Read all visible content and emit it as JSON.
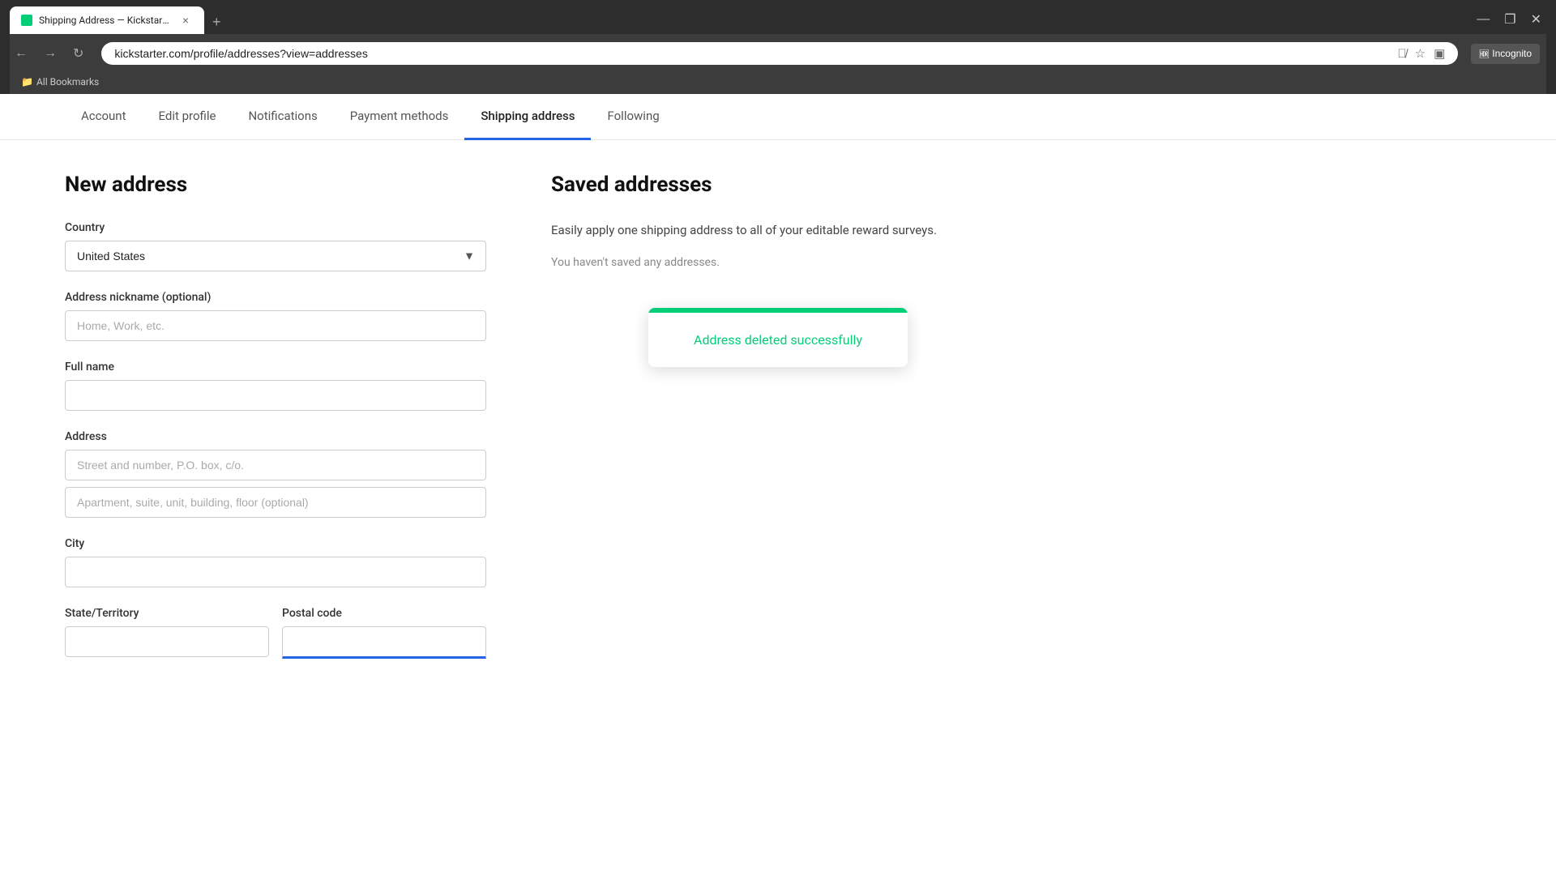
{
  "browser": {
    "tab_title": "Shipping Address — Kickstarter",
    "tab_close": "×",
    "tab_new": "+",
    "url": "kickstarter.com/profile/addresses?view=addresses",
    "window_close": "✕",
    "window_minimize": "—",
    "window_maximize": "❐",
    "incognito_label": "Incognito",
    "bookmarks_label": "All Bookmarks"
  },
  "nav": {
    "items": [
      {
        "label": "Account",
        "active": false
      },
      {
        "label": "Edit profile",
        "active": false
      },
      {
        "label": "Notifications",
        "active": false
      },
      {
        "label": "Payment methods",
        "active": false
      },
      {
        "label": "Shipping address",
        "active": true
      },
      {
        "label": "Following",
        "active": false
      }
    ]
  },
  "form": {
    "section_title": "New address",
    "country_label": "Country",
    "country_value": "United States",
    "nickname_label": "Address nickname (optional)",
    "nickname_placeholder": "Home, Work, etc.",
    "fullname_label": "Full name",
    "address_label": "Address",
    "address_line1_placeholder": "Street and number, P.O. box, c/o.",
    "address_line2_placeholder": "Apartment, suite, unit, building, floor (optional)",
    "city_label": "City",
    "state_label": "State/Territory",
    "postal_label": "Postal code"
  },
  "saved": {
    "section_title": "Saved addresses",
    "description": "Easily apply one shipping address to all of your editable reward surveys.",
    "no_addresses_text": "You haven't saved any addresses."
  },
  "toast": {
    "message": "Address deleted successfully"
  }
}
